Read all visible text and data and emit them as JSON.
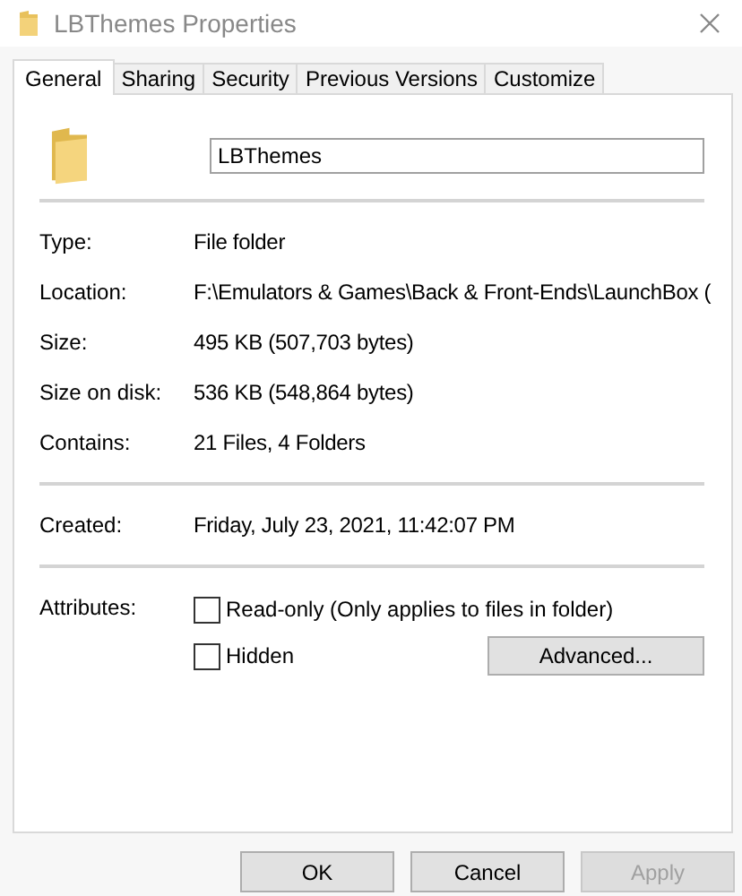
{
  "window": {
    "title": "LBThemes Properties"
  },
  "tabs": [
    {
      "label": "General",
      "selected": true
    },
    {
      "label": "Sharing",
      "selected": false
    },
    {
      "label": "Security",
      "selected": false
    },
    {
      "label": "Previous Versions",
      "selected": false
    },
    {
      "label": "Customize",
      "selected": false
    }
  ],
  "name_field": {
    "value": "LBThemes"
  },
  "sections": [
    [
      {
        "label": "Type:",
        "value": "File folder"
      },
      {
        "label": "Location:",
        "value": "F:\\Emulators & Games\\Back & Front-Ends\\LaunchBox ("
      },
      {
        "label": "Size:",
        "value": "495 KB (507,703 bytes)"
      },
      {
        "label": "Size on disk:",
        "value": "536 KB (548,864 bytes)"
      },
      {
        "label": "Contains:",
        "value": "21 Files, 4 Folders"
      }
    ],
    [
      {
        "label": "Created:",
        "value": "Friday, July 23, 2021, 11:42:07 PM"
      }
    ]
  ],
  "attributes": {
    "label": "Attributes:",
    "checkboxes": [
      {
        "label": "Read-only (Only applies to files in folder)",
        "checked": false
      },
      {
        "label": "Hidden",
        "checked": false
      }
    ],
    "advanced_button": "Advanced..."
  },
  "buttons": [
    {
      "label": "OK",
      "disabled": false
    },
    {
      "label": "Cancel",
      "disabled": false
    },
    {
      "label": "Apply",
      "disabled": true
    }
  ]
}
